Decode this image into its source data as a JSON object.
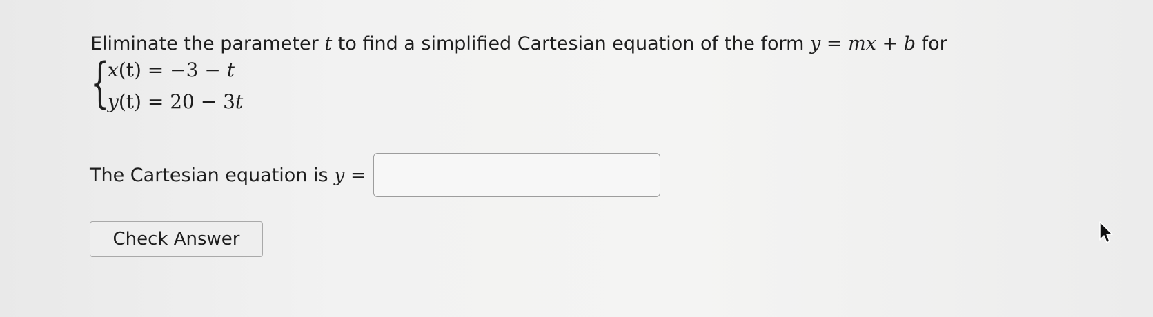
{
  "question": {
    "prompt_start": "Eliminate the parameter ",
    "param": "t",
    "prompt_mid": " to find a simplified Cartesian equation of the form ",
    "form_y": "y",
    "form_eq": " = ",
    "form_m": "m",
    "form_x": "x",
    "form_plus": " + ",
    "form_b": "b",
    "prompt_end": " for",
    "brace": "{",
    "eq1": {
      "lhs_var": "x",
      "lhs_arg": "(t)",
      "rhs_const": " = −3 − ",
      "rhs_var": "t"
    },
    "eq2": {
      "lhs_var": "y",
      "lhs_arg": "(t)",
      "rhs_const": " = 20 − 3",
      "rhs_var": "t"
    }
  },
  "answer": {
    "label": "The Cartesian equation is ",
    "var": "y",
    "equals": " =",
    "value": ""
  },
  "check_button": {
    "label": "Check Answer"
  },
  "cursor": {
    "icon": "mouse-pointer-icon"
  }
}
